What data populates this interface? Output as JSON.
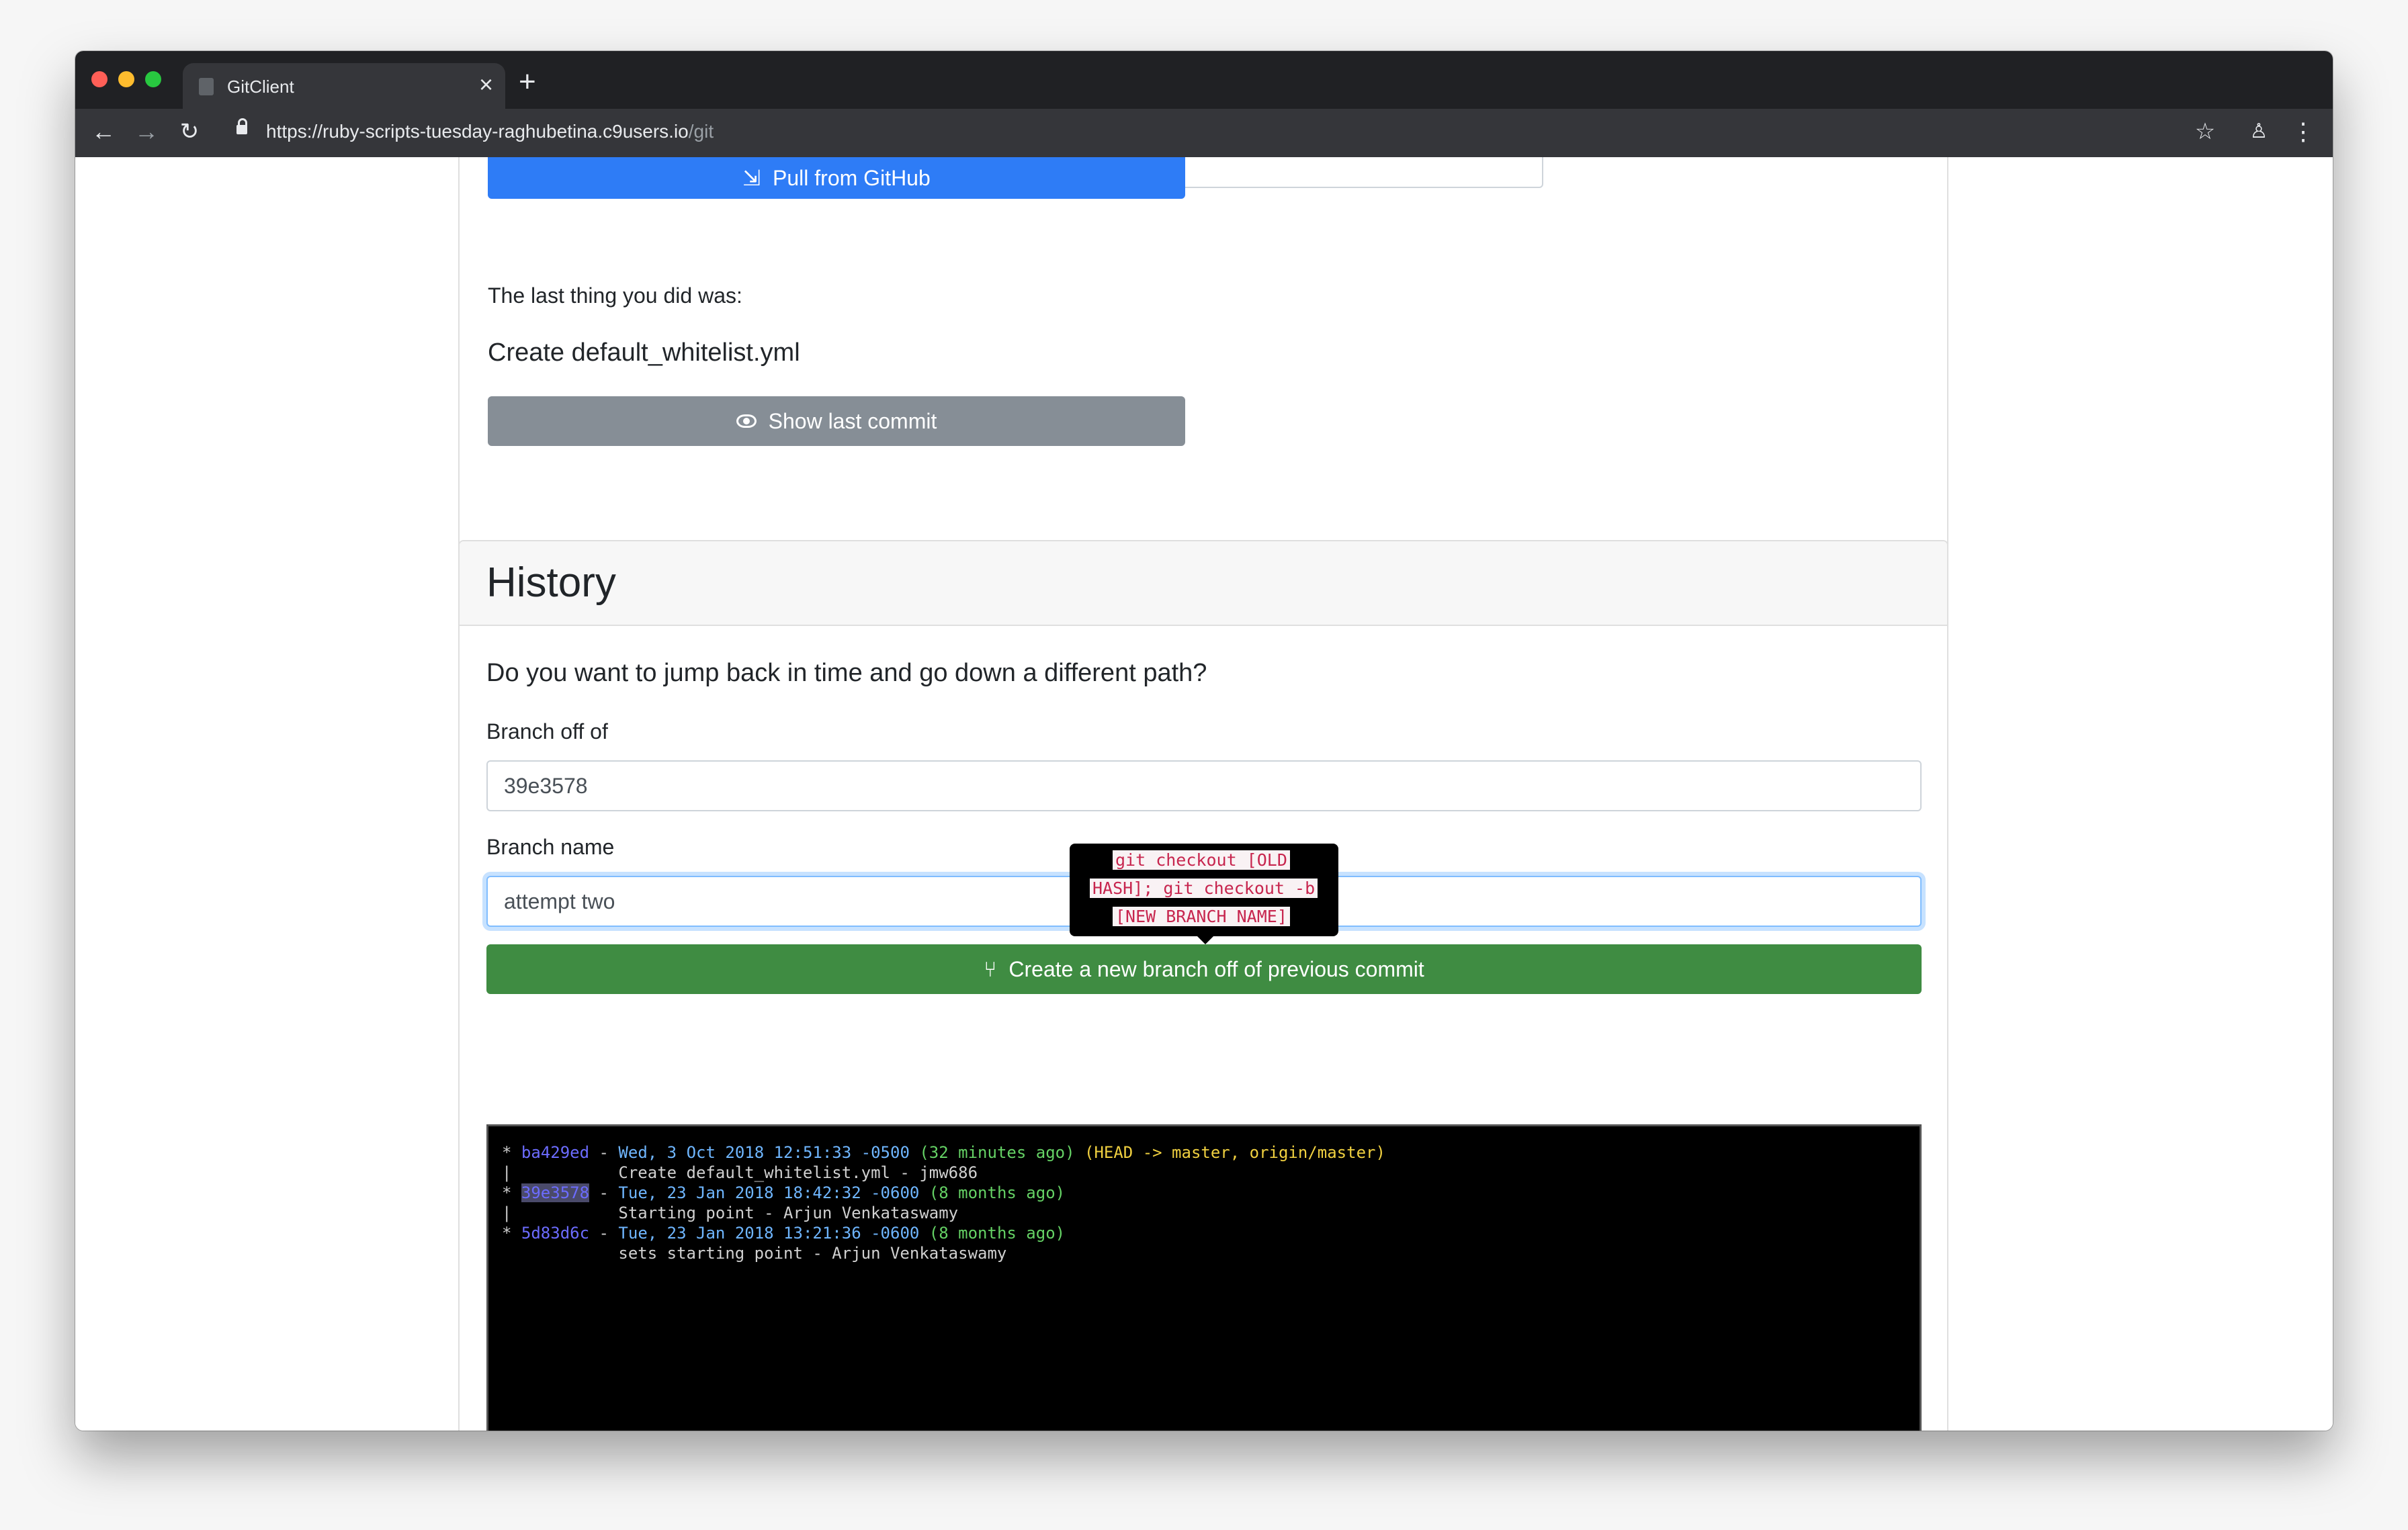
{
  "browser": {
    "tab_title": "GitClient",
    "tab_close": "×",
    "new_tab": "+",
    "url_host": "https://ruby-scripts-tuesday-raghubetina.c9users.io",
    "url_path": "/git"
  },
  "sync": {
    "pull_label": "Pull from GitHub",
    "last_thing_label": "The last thing you did was:",
    "last_commit_message": "Create default_whitelist.yml",
    "show_last_commit_label": "Show last commit"
  },
  "history": {
    "title": "History",
    "question": "Do you want to jump back in time and go down a different path?",
    "branch_off_label": "Branch off of",
    "branch_off_value": "39e3578",
    "branch_name_label": "Branch name",
    "branch_name_value": "attempt two",
    "tooltip_lines": [
      "git checkout [OLD",
      "HASH]; git checkout -b",
      "[NEW BRANCH NAME]"
    ],
    "create_branch_label": "Create a new branch off of previous commit"
  },
  "log": [
    {
      "graph": "* ",
      "hash": "ba429ed",
      "sep": " - ",
      "date": "Wed, 3 Oct 2018 12:51:33 -0500",
      "rel": " (32 minutes ago)",
      "ref": " (HEAD -> master, origin/master)"
    },
    {
      "graph": "|           ",
      "msg": "Create default_whitelist.yml - jmw686"
    },
    {
      "graph": "* ",
      "hash": "39e3578",
      "sep": " - ",
      "date": "Tue, 23 Jan 2018 18:42:32 -0600",
      "rel": " (8 months ago)"
    },
    {
      "graph": "|           ",
      "msg": "Starting point - Arjun Venkataswamy"
    },
    {
      "graph": "* ",
      "hash": "5d83d6c",
      "sep": " - ",
      "date": "Tue, 23 Jan 2018 13:21:36 -0600",
      "rel": " (8 months ago)"
    },
    {
      "graph": "            ",
      "msg": "sets starting point - Arjun Venkataswamy"
    }
  ],
  "colors": {
    "pull_button": "#2e7cf6",
    "show_commit_button": "#868e96",
    "create_branch_button": "#3f8c42",
    "terminal_bg": "#000000"
  }
}
